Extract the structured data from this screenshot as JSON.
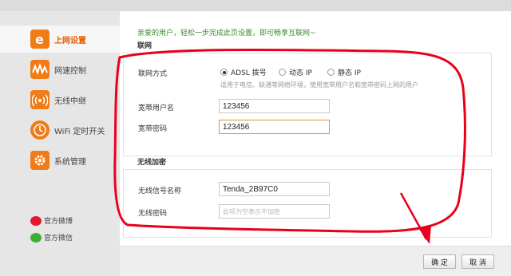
{
  "sidebar": {
    "items": [
      {
        "label": "上网设置",
        "icon": "internet-e-icon"
      },
      {
        "label": "网速控制",
        "icon": "speed-wave-icon"
      },
      {
        "label": "无线中继",
        "icon": "wireless-relay-icon"
      },
      {
        "label": "WiFi 定时开关",
        "icon": "wifi-timer-icon"
      },
      {
        "label": "系统管理",
        "icon": "gear-icon"
      }
    ],
    "social": [
      {
        "label": "官方微博",
        "icon": "weibo-icon"
      },
      {
        "label": "官方微信",
        "icon": "wechat-icon"
      }
    ]
  },
  "main": {
    "welcome": "亲爱的用户，轻松一步完成此页设置，即可畅享互联网~",
    "network": {
      "section_title": "联网",
      "mode_label": "联网方式",
      "modes": [
        "ADSL 拨号",
        "动态 IP",
        "静态 IP"
      ],
      "selected_mode": "ADSL 拨号",
      "hint": "适用于电信、联通等网络环境，使用宽带用户名和宽带密码上网的用户",
      "username_label": "宽带用户名",
      "username_value": "123456",
      "password_label": "宽带密码",
      "password_value": "123456"
    },
    "wireless": {
      "section_title": "无线加密",
      "ssid_label": "无线信号名称",
      "ssid_value": "Tenda_2B97C0",
      "password_label": "无线密码",
      "password_placeholder": "此项为空表示不加密"
    }
  },
  "footer": {
    "confirm_label": "确 定",
    "cancel_label": "取 消"
  },
  "colors": {
    "accent_orange": "#f07c18",
    "welcome_green": "#3a8c2a",
    "annotation_red": "#e8001c"
  }
}
